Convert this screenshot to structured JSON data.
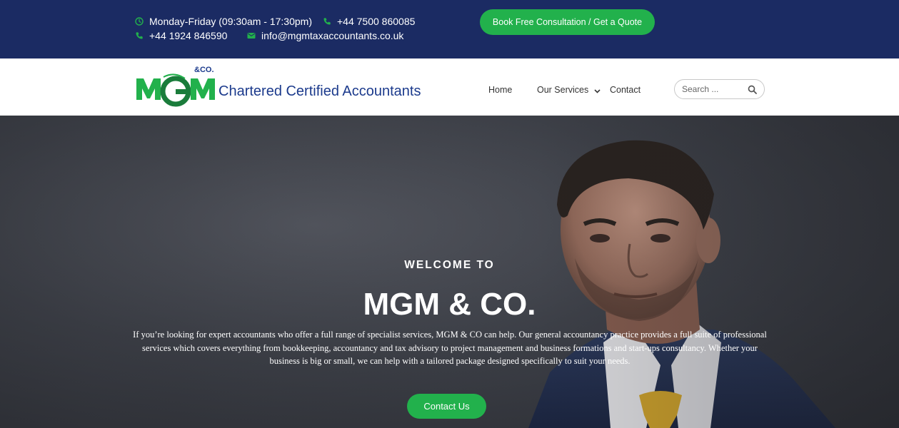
{
  "topbar": {
    "hours": "Monday-Friday (09:30am - 17:30pm)",
    "phone_landline": "+44 1924 846590",
    "phone_mobile": "+44 7500 860085",
    "email": "info@mgmtaxaccountants.co.uk",
    "cta_label": "Book Free Consultation / Get a Quote",
    "icon_color": "#22b14c",
    "background": "#1b2b63"
  },
  "header": {
    "logo": {
      "mark": "MGM",
      "mark_suffix": "&CO.",
      "tagline": "Chartered Certified Accountants"
    },
    "nav": [
      {
        "label": "Home"
      },
      {
        "label": "Our Services"
      },
      {
        "label": "Contact"
      }
    ],
    "search": {
      "placeholder": "Search ..."
    }
  },
  "hero": {
    "kicker": "WELCOME TO",
    "title": "MGM & CO.",
    "description": "If you’re looking for expert accountants who offer a full range of specialist services, MGM & CO can help. Our general accountancy practice provides a full suite of professional services which covers everything from bookkeeping, accountancy and tax advisory to project management and business formations and start-ups consultancy. Whether your business is big or small, we can help with a tailored package designed specifically to suit your needs.",
    "cta_label": "Contact Us"
  },
  "colors": {
    "brand_green": "#22b14c",
    "brand_navy": "#1b2b63",
    "logo_blue": "#1b3a8c"
  }
}
